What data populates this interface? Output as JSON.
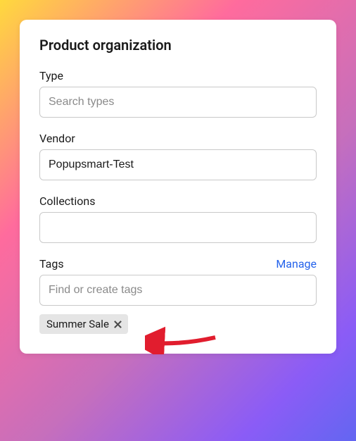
{
  "card": {
    "title": "Product organization"
  },
  "type": {
    "label": "Type",
    "placeholder": "Search types",
    "value": ""
  },
  "vendor": {
    "label": "Vendor",
    "value": "Popupsmart-Test"
  },
  "collections": {
    "label": "Collections",
    "value": ""
  },
  "tags": {
    "label": "Tags",
    "manage_label": "Manage",
    "placeholder": "Find or create tags",
    "value": "",
    "items": [
      {
        "label": "Summer Sale"
      }
    ]
  }
}
